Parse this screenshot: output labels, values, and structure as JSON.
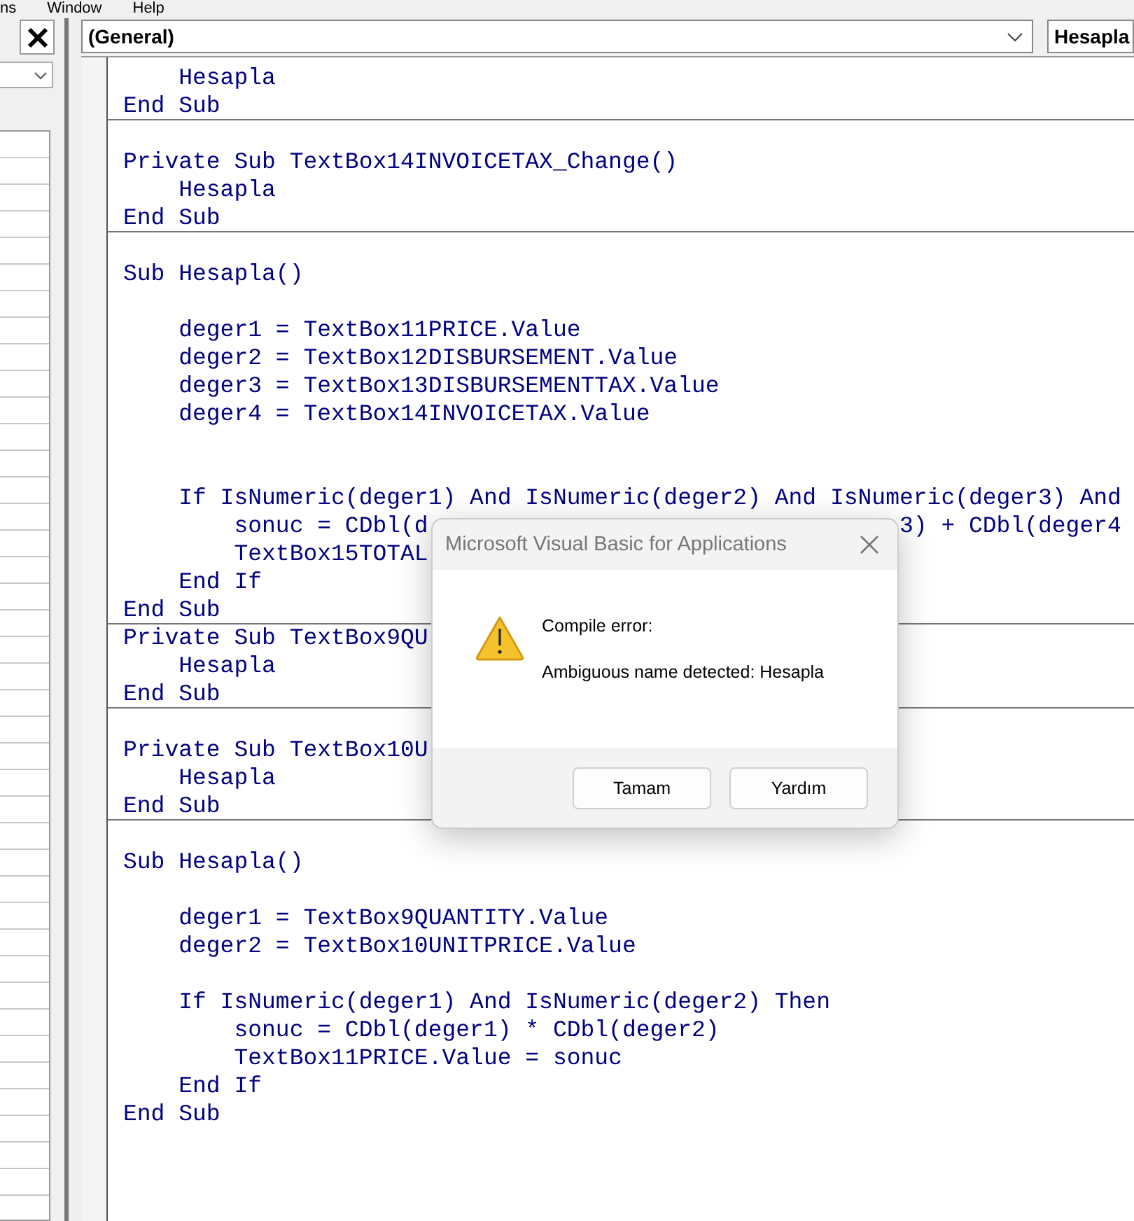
{
  "menu_bar": {
    "items": [
      {
        "label": "ns"
      },
      {
        "label": "Window"
      },
      {
        "label": "Help"
      }
    ]
  },
  "code_window": {
    "object_combo": "(General)",
    "procedure_combo": "Hesapla",
    "lines": [
      {
        "text": "    Hesapla",
        "divider_after": false
      },
      {
        "text": "End Sub",
        "divider_after": true
      },
      {
        "divider_after": false
      },
      {
        "text": "Private Sub TextBox14INVOICETAX_Change()",
        "divider_after": false
      },
      {
        "text": "    Hesapla",
        "divider_after": false
      },
      {
        "text": "End Sub",
        "divider_after": true
      },
      {
        "divider_after": false
      },
      {
        "text": "Sub Hesapla()",
        "divider_after": false
      },
      {
        "divider_after": false
      },
      {
        "text": "    deger1 = TextBox11PRICE.Value",
        "divider_after": false
      },
      {
        "text": "    deger2 = TextBox12DISBURSEMENT.Value",
        "divider_after": false
      },
      {
        "text": "    deger3 = TextBox13DISBURSEMENTTAX.Value",
        "divider_after": false
      },
      {
        "text": "    deger4 = TextBox14INVOICETAX.Value",
        "divider_after": false
      },
      {
        "divider_after": false
      },
      {
        "divider_after": false
      },
      {
        "text": "    If IsNumeric(deger1) And IsNumeric(deger2) And IsNumeric(deger3) And",
        "divider_after": false
      },
      {
        "text": "        sonuc = CDbl(d",
        "tail": "3) + CDbl(deger4",
        "divider_after": false
      },
      {
        "text": "        TextBox15TOTAL",
        "divider_after": false
      },
      {
        "text": "    End If",
        "divider_after": false
      },
      {
        "text": "End Sub",
        "divider_after": true
      },
      {
        "text": "Private Sub TextBox9QU",
        "divider_after": false
      },
      {
        "text": "    Hesapla",
        "divider_after": false
      },
      {
        "text": "End Sub",
        "divider_after": true
      },
      {
        "divider_after": false
      },
      {
        "text": "Private Sub TextBox10U",
        "divider_after": false
      },
      {
        "text": "    Hesapla",
        "divider_after": false
      },
      {
        "text": "End Sub",
        "divider_after": true
      },
      {
        "divider_after": false
      },
      {
        "text": "Sub Hesapla()",
        "divider_after": false
      },
      {
        "divider_after": false
      },
      {
        "text": "    deger1 = TextBox9QUANTITY.Value",
        "divider_after": false
      },
      {
        "text": "    deger2 = TextBox10UNITPRICE.Value",
        "divider_after": false
      },
      {
        "divider_after": false
      },
      {
        "text": "    If IsNumeric(deger1) And IsNumeric(deger2) Then",
        "divider_after": false
      },
      {
        "text": "        sonuc = CDbl(deger1) * CDbl(deger2)",
        "divider_after": false
      },
      {
        "text": "        TextBox11PRICE.Value = sonuc",
        "divider_after": false
      },
      {
        "text": "    End If",
        "divider_after": false
      },
      {
        "text": "End Sub",
        "divider_after": false
      }
    ]
  },
  "dialog": {
    "title": "Microsoft Visual Basic for Applications",
    "heading": "Compile error:",
    "message": "Ambiguous name detected: Hesapla",
    "buttons": [
      "Tamam",
      "Yardım"
    ]
  }
}
